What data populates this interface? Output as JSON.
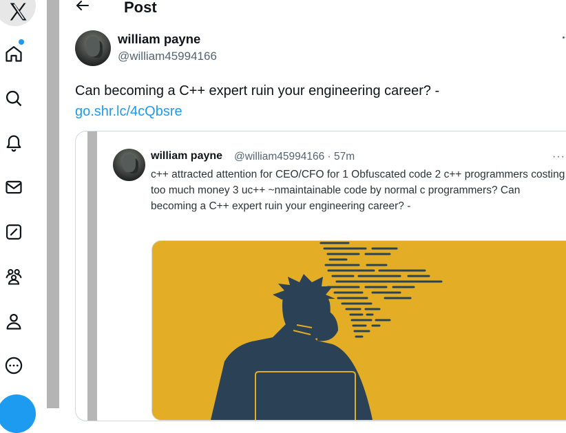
{
  "nav": {
    "items": [
      "x-logo-icon",
      "home-icon",
      "search-icon",
      "notifications-icon",
      "messages-icon",
      "grok-icon",
      "communities-icon",
      "profile-icon",
      "more-icon"
    ],
    "accent": "#1d9bf0"
  },
  "header": {
    "title": "Post"
  },
  "post": {
    "author_name": "william payne",
    "author_handle": "@william45994166",
    "text": "Can becoming a C++ expert ruin your engineering career? -",
    "link": "go.shr.lc/4cQbsre"
  },
  "quote": {
    "author_name": "william payne",
    "meta": "@william45994166 · 57m",
    "more": "···",
    "text": "c++ attracted attention for CEO/CFO for 1 Obfuscated code 2 c++ programmers costing too much money 3 uc++ ~nmaintainable code by normal c programmers?  Can becoming a C++ expert ruin your engineering career? -",
    "image_colors": {
      "background": "#e3ad26",
      "figure": "#2b4256"
    }
  }
}
